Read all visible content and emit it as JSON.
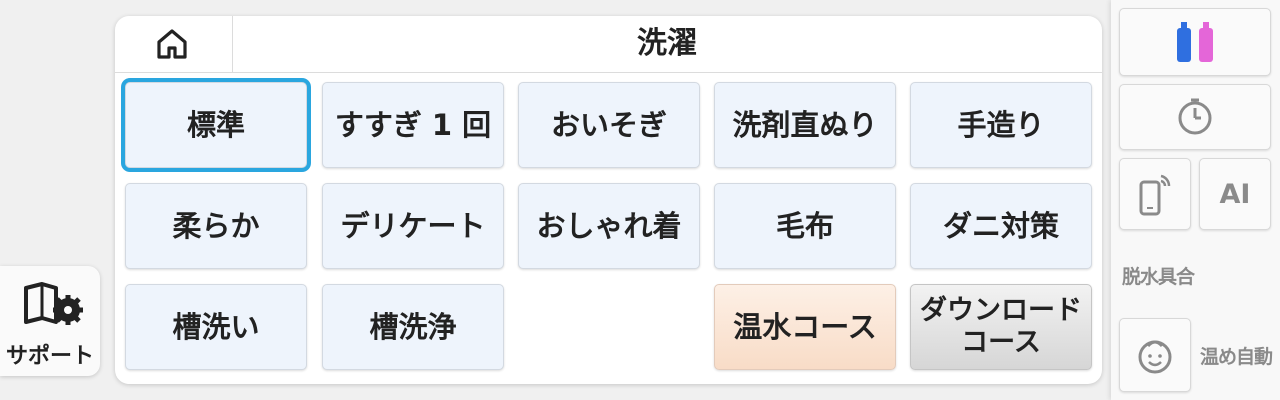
{
  "support": {
    "label": "サポート",
    "icon": "book-gear-icon"
  },
  "header": {
    "title": "洗濯",
    "home_icon": "home-icon"
  },
  "courses": [
    {
      "label": "標準"
    },
    {
      "label": "すすぎ 1 回"
    },
    {
      "label": "おいそぎ"
    },
    {
      "label": "洗剤直ぬり"
    },
    {
      "label": "手造り"
    },
    {
      "label": "柔らか"
    },
    {
      "label": "デリケート"
    },
    {
      "label": "おしゃれ着"
    },
    {
      "label": "毛布"
    },
    {
      "label": "ダニ対策"
    },
    {
      "label": "槽洗い"
    },
    {
      "label": "槽洗浄"
    },
    {
      "label": "温水コース"
    },
    {
      "label_line1": "ダウンロード",
      "label_line2": "コース"
    }
  ],
  "selected_course": "標準",
  "right_panel": {
    "detergent_icon": "detergent-bottles-icon",
    "timer_icon": "timer-icon",
    "remote_icon": "smartphone-remote-icon",
    "ai_label": "AI",
    "dehydrate_label": "脱水具合",
    "child_icon": "child-face-icon",
    "warm_auto_label": "温め自動"
  },
  "colors": {
    "selected_outline": "#2aa6df",
    "button_bg": "#eef4fc",
    "warm_button_bg": "#f8dcc7",
    "detergent_blue": "#2f6fe0",
    "softener_pink": "#e466d8"
  }
}
